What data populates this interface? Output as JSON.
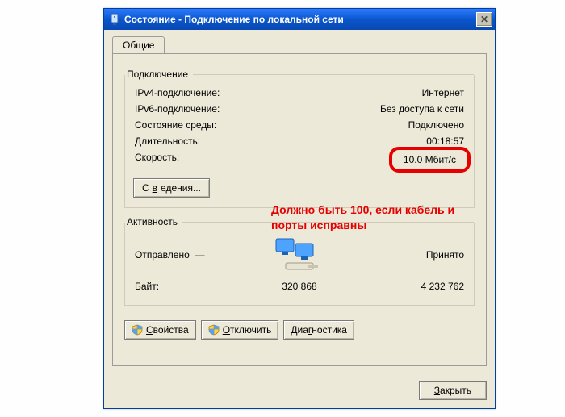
{
  "window": {
    "title": "Состояние - Подключение по локальной сети"
  },
  "tabs": {
    "general": "Общие"
  },
  "group_connection": {
    "legend": "Подключение",
    "rows": {
      "ipv4_k": "IPv4-подключение:",
      "ipv4_v": "Интернет",
      "ipv6_k": "IPv6-подключение:",
      "ipv6_v": "Без доступа к сети",
      "media_k": "Состояние среды:",
      "media_v": "Подключено",
      "dur_k": "Длительность:",
      "dur_v": "00:18:57",
      "speed_k": "Скорость:",
      "speed_v": "10.0 Мбит/с"
    },
    "details_btn": {
      "pre": "С",
      "u": "в",
      "post": "едения..."
    }
  },
  "annotation": "Должно быть 100, если кабель и порты исправны",
  "group_activity": {
    "legend": "Активность",
    "sent_label": "Отправлено",
    "line_sep": "—",
    "recv_label": "Принято",
    "bytes_label": "Байт:",
    "sent_bytes": "320 868",
    "recv_bytes": "4 232 762"
  },
  "buttons": {
    "properties": {
      "u": "С",
      "post": "войства"
    },
    "disable": {
      "u": "О",
      "post": "тключить"
    },
    "diag": {
      "pre": "Диа",
      "u": "г",
      "post": "ностика"
    },
    "close": {
      "u": "З",
      "post": "акрыть"
    }
  }
}
